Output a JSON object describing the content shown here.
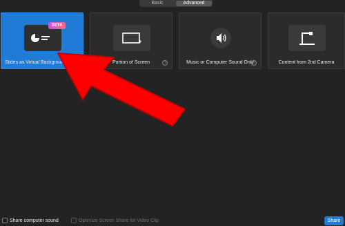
{
  "tabs": [
    {
      "label": "Basic",
      "active": false
    },
    {
      "label": "Advanced",
      "active": true
    }
  ],
  "options": [
    {
      "label": "Slides as Virtual Background",
      "badge": "BETA",
      "selected": true,
      "icon": "slides-icon"
    },
    {
      "label": "Portion of Screen",
      "selected": false,
      "icon": "screen-portion-icon",
      "help": "?"
    },
    {
      "label": "Music or Computer Sound Only",
      "selected": false,
      "icon": "speaker-icon",
      "help": "?"
    },
    {
      "label": "Content from 2nd Camera",
      "selected": false,
      "icon": "camera-icon"
    }
  ],
  "bottom": {
    "share_sound_label": "Share computer sound",
    "optimize_label": "Optimize Screen Share for Video Clip",
    "share_button": "Share"
  },
  "annotation": {
    "type": "arrow",
    "color": "#ff0000"
  },
  "colors": {
    "accent": "#1f7bd6",
    "background": "#232323"
  }
}
